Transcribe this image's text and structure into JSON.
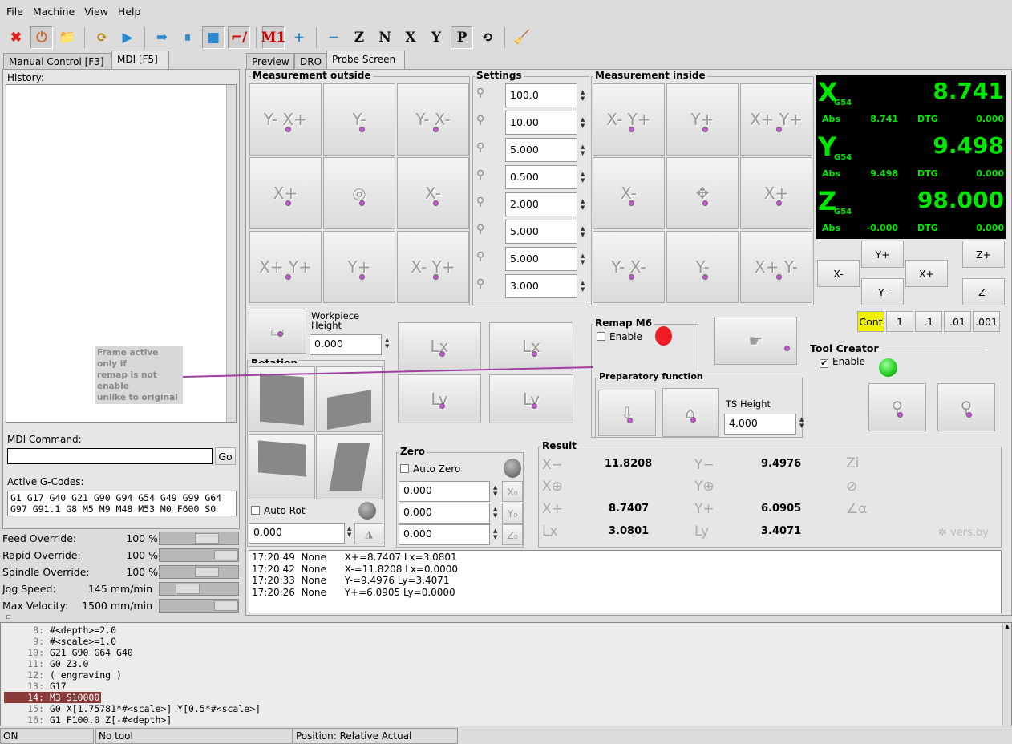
{
  "menu": [
    "File",
    "Machine",
    "View",
    "Help"
  ],
  "toolbar": {
    "icons": [
      "estop-icon",
      "power-icon",
      "open-file-icon",
      "reload-icon",
      "run-icon",
      "step-icon",
      "pause-icon",
      "stop-icon",
      "block-delete-icon",
      "optional-stop-icon",
      "zoom-in-icon",
      "zoom-out-icon",
      "view-z-icon",
      "view-z2-icon",
      "view-x-icon",
      "view-y-icon",
      "view-p-icon",
      "rotate-view-icon",
      "clear-plot-icon"
    ],
    "glyphs": [
      "✖",
      "⏻",
      "📁",
      "⟳",
      "▶",
      "➡",
      "⏸",
      "■",
      "⌐/",
      "M1",
      "+",
      "−",
      "Z",
      "N",
      "X",
      "Y",
      "P",
      "⟲",
      "🧹"
    ]
  },
  "left_tabs": [
    "Manual Control [F3]",
    "MDI [F5]"
  ],
  "right_tabs": [
    "Preview",
    "DRO",
    "Probe Screen"
  ],
  "mdi": {
    "history_label": "History:",
    "command_label": "MDI Command:",
    "go": "Go",
    "gcodes_label": "Active G-Codes:",
    "gcodes": [
      "G1 G17 G40 G21 G90 G94 G54 G49 G99 G64",
      "G97 G91.1 G8 M5 M9 M48 M53 M0 F600 S0"
    ]
  },
  "annotation": [
    "Frame active only if",
    "remap is not enable",
    "unlike to original"
  ],
  "overrides": [
    {
      "label": "Feed Override:",
      "value": "100 %",
      "pos": 0.65
    },
    {
      "label": "Rapid Override:",
      "value": "100 %",
      "pos": 1.0
    },
    {
      "label": "Spindle Override:",
      "value": "100 %",
      "pos": 0.65
    },
    {
      "label": "Jog Speed:",
      "value": "145 mm/min",
      "pos": 0.3
    },
    {
      "label": "Max Velocity:",
      "value": "1500 mm/min",
      "pos": 1.0
    }
  ],
  "probe": {
    "meas_outside": "Measurement outside",
    "outside_buttons": [
      "Y- X+",
      "Y-",
      "Y- X-",
      "X+",
      "◎",
      "X-",
      "X+ Y+",
      "Y+",
      "X- Y+"
    ],
    "settings": "Settings",
    "settings_values": [
      "100.0",
      "10.00",
      "5.000",
      "0.500",
      "2.000",
      "5.000",
      "5.000",
      "3.000"
    ],
    "meas_inside": "Measurement inside",
    "inside_buttons": [
      "X- Y+",
      "Y+",
      "X+ Y+",
      "X-",
      "✥",
      "X+",
      "Y- X-",
      "Y-",
      "X+ Y-"
    ],
    "workpiece_label": "Workpiece Height",
    "workpiece_value": "0.000",
    "length_buttons": [
      "Lx",
      "Lx",
      "Ly",
      "Ly"
    ],
    "rotation": "Rotation",
    "auto_rot": "Auto Rot",
    "rot_value": "0.000",
    "remap": "Remap M6",
    "remap_enable": "Enable",
    "prep": "Preparatory function",
    "ts_label": "TS Height",
    "ts_value": "4.000",
    "tool_creator": "Tool Creator",
    "tc_enable": "Enable",
    "zero": "Zero",
    "auto_zero": "Auto Zero",
    "zero_values": [
      "0.000",
      "0.000",
      "0.000"
    ],
    "zero_buttons": [
      "X₀",
      "Y₀",
      "Z₀"
    ],
    "result": "Result",
    "results": {
      "xm": "11.8208",
      "ym": "9.4976",
      "xp": "8.7407",
      "yp": "6.0905",
      "lx": "3.0801",
      "ly": "3.4071"
    },
    "result_labels": {
      "xm": "X−",
      "ym": "Y−",
      "xc": "X⊕",
      "yc": "Y⊕",
      "xp": "X+",
      "yp": "Y+",
      "lx": "Lx",
      "ly": "Ly",
      "z": "Zi",
      "d": "⊘",
      "a": "∠α"
    },
    "brand": "vers.by",
    "log": [
      "17:20:49  None      X+=8.7407 Lx=3.0801",
      "17:20:42  None      X-=11.8208 Lx=0.0000",
      "17:20:33  None      Y-=9.4976 Ly=3.4071",
      "17:20:26  None      Y+=6.0905 Ly=0.0000"
    ]
  },
  "dro": {
    "axes": [
      {
        "axis": "X",
        "sys": "G54",
        "value": "8.741",
        "abs": "8.741",
        "dtg": "0.000"
      },
      {
        "axis": "Y",
        "sys": "G54",
        "value": "9.498",
        "abs": "9.498",
        "dtg": "0.000"
      },
      {
        "axis": "Z",
        "sys": "G54",
        "value": "98.000",
        "abs": "-0.000",
        "dtg": "0.000"
      }
    ],
    "abs_label": "Abs",
    "dtg_label": "DTG"
  },
  "jog": {
    "xm": "X-",
    "xp": "X+",
    "yp": "Y+",
    "ym": "Y-",
    "zp": "Z+",
    "zm": "Z-",
    "increments": [
      "Cont",
      "1",
      ".1",
      ".01",
      ".001"
    ]
  },
  "gcode": [
    {
      "n": "8:",
      "t": "#<depth>=2.0"
    },
    {
      "n": "9:",
      "t": "#<scale>=1.0"
    },
    {
      "n": "10:",
      "t": "G21 G90 G64 G40"
    },
    {
      "n": "11:",
      "t": "G0 Z3.0"
    },
    {
      "n": "12:",
      "t": "( engraving )"
    },
    {
      "n": "13:",
      "t": "G17"
    },
    {
      "n": "14:",
      "t": "M3 S10000",
      "active": true
    },
    {
      "n": "15:",
      "t": "G0 X[1.75781*#<scale>] Y[0.5*#<scale>]"
    },
    {
      "n": "16:",
      "t": "G1 F100.0 Z[-#<depth>]"
    }
  ],
  "status": [
    "ON",
    "No tool",
    "Position: Relative Actual"
  ],
  "colors": {
    "dro_green": "#00e800",
    "highlight": "#8b3a3a",
    "cont": "#f0f000",
    "led_red": "#ee1c24",
    "led_green": "#22cc22"
  }
}
